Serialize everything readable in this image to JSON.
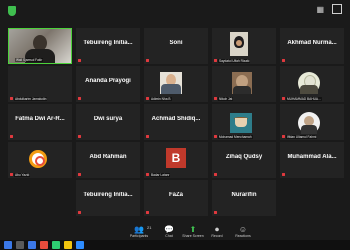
{
  "participants": [
    {
      "id": "p01",
      "label": "Wali Sjamsul Fakir",
      "display_name": "",
      "active": true
    },
    {
      "id": "p02",
      "display_name": "Tebuireng Initia...",
      "label": ""
    },
    {
      "id": "p03",
      "display_name": "Soni",
      "label": ""
    },
    {
      "id": "p04",
      "label": "Saydatul Ulfah Rizaki",
      "display_name": ""
    },
    {
      "id": "p05",
      "display_name": "Akhmad Nurma...",
      "label": ""
    },
    {
      "id": "p06",
      "label": "Abdulkarim Jamaludin",
      "display_name": ""
    },
    {
      "id": "p07",
      "display_name": "Ananda Prayogi",
      "label": ""
    },
    {
      "id": "p08",
      "label": "Adimin Nha B",
      "display_name": ""
    },
    {
      "id": "p09",
      "label": "Nikoh Jat",
      "display_name": ""
    },
    {
      "id": "p10",
      "label": "MUHAMMAD BAHUA...",
      "display_name": ""
    },
    {
      "id": "p11",
      "display_name": "Fatma Dwi Ar-R...",
      "label": ""
    },
    {
      "id": "p12",
      "display_name": "Dwi surya",
      "label": ""
    },
    {
      "id": "p13",
      "display_name": "Achmad Shidiq...",
      "label": ""
    },
    {
      "id": "p14",
      "label": "Mohamad Menchamah",
      "display_name": ""
    },
    {
      "id": "p15",
      "label": "Iffdan Ultamul Fahmi",
      "display_name": ""
    },
    {
      "id": "p16",
      "label": "Abu Yazid",
      "display_name": ""
    },
    {
      "id": "p17",
      "display_name": "Abd Rahman",
      "label": ""
    },
    {
      "id": "p18",
      "label": "Badar Latanr",
      "display_name": "",
      "avatar_letter": "B"
    },
    {
      "id": "p19",
      "display_name": "Zihaq Qudsy",
      "label": ""
    },
    {
      "id": "p20",
      "display_name": "Muhammad Ala...",
      "label": ""
    },
    {
      "id": "p21",
      "display_name": "Tebuireng Initia...",
      "label": ""
    },
    {
      "id": "p22",
      "display_name": "FaZa",
      "label": ""
    },
    {
      "id": "p23",
      "display_name": "Nurarifin",
      "label": ""
    }
  ],
  "toolbar": {
    "participants_count": "21",
    "items": [
      {
        "label": "Participants",
        "icon": "participants-icon"
      },
      {
        "label": "Chat",
        "icon": "chat-icon"
      },
      {
        "label": "Share Screen",
        "icon": "share-screen-icon"
      },
      {
        "label": "Record",
        "icon": "record-icon"
      },
      {
        "label": "Reactions",
        "icon": "reactions-icon"
      }
    ]
  },
  "taskbar": {
    "time": "",
    "date": ""
  },
  "colors": {
    "background": "#1a1a1a",
    "tile": "#232323",
    "active_border": "#4cd23a",
    "mute": "#e0393e",
    "share_green": "#3fbf4f",
    "avatar_red": "#c0392b"
  }
}
